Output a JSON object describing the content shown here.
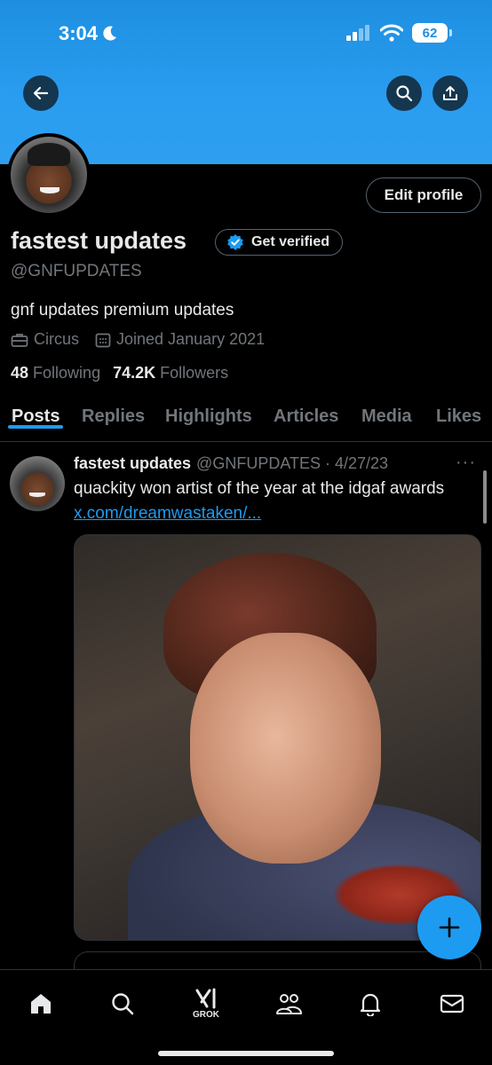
{
  "status_bar": {
    "time": "3:04",
    "battery": "62"
  },
  "profile": {
    "display_name": "fastest updates",
    "handle": "@GNFUPDATES",
    "bio": "gnf updates premium updates",
    "category": "Circus",
    "joined": "Joined January 2021",
    "following_count": "48",
    "following_label": "Following",
    "followers_count": "74.2K",
    "followers_label": "Followers",
    "edit_label": "Edit profile",
    "verify_label": "Get verified"
  },
  "tabs": [
    "Posts",
    "Replies",
    "Highlights",
    "Articles",
    "Media",
    "Likes"
  ],
  "post": {
    "name": "fastest updates",
    "handle_date": "@GNFUPDATES · 4/27/23",
    "text": "quackity won artist of the year at the idgaf awards",
    "link": "x.com/dreamwastaken/...",
    "more": "···"
  },
  "bottom_nav": {
    "grok_label": "GROK"
  },
  "colors": {
    "accent": "#1d9bf0",
    "banner": "#2a9df0",
    "background": "#000000",
    "muted": "#71767b"
  }
}
